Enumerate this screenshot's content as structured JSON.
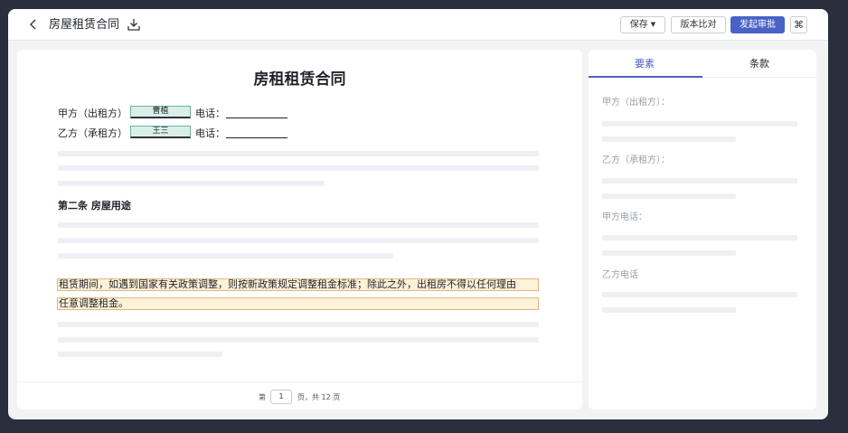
{
  "header": {
    "title": "房屋租赁合同",
    "save_label": "保存",
    "save_caret": "▼",
    "compare_label": "版本比对",
    "submit_label": "发起审批",
    "command_glyph": "⌘"
  },
  "document": {
    "title": "房租租赁合同",
    "party_a": {
      "label": "甲方（出租方）",
      "name": "曹植",
      "phone_label": "电话："
    },
    "party_b": {
      "label": "乙方（承租方）",
      "name": "王三",
      "phone_label": "电话："
    },
    "section_title": "第二条 房屋用途",
    "highlight_line1": "租赁期间，如遇到国家有关政策调整，则按新政策规定调整租金标准；除此之外，出租房不得以任何理由",
    "highlight_line2": "任意调整租金。"
  },
  "pager": {
    "prefix": "第",
    "current_page": "1",
    "suffix": "页，共 12 页"
  },
  "side_panel": {
    "tabs": [
      "要素",
      "条款"
    ],
    "active_tab": "要素",
    "fields": [
      "甲方（出租方）：",
      "乙方（承租方）：",
      "甲方电话：",
      "乙方电话"
    ]
  },
  "colors": {
    "accent": "#4a62c5",
    "highlight_bg": "#fdf1d8",
    "name_field_bg": "#d9efe9"
  },
  "icons": {
    "back": "chevron-left-icon",
    "download": "download-icon"
  }
}
